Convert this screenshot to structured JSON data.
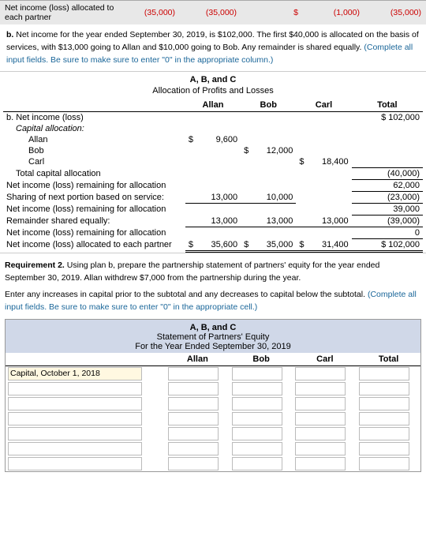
{
  "topRow": {
    "label": "Net income (loss) allocated to each partner",
    "values": [
      "(35,000)",
      "(35,000)",
      "$",
      "(1,000)",
      "(35,000)"
    ]
  },
  "noteB": {
    "text": "b. Net income for the year ended September 30, 2019, is $102,000. The first $40,000 is allocated on the basis of services, with $13,000 going to Allan and $10,000 going to Bob. Any remainder is shared equally.",
    "highlight": "(Complete all input fields. Be sure to make sure to enter \"0\" in the appropriate column.)"
  },
  "allocationTable": {
    "title": "A, B, and C",
    "subtitle": "Allocation of Profits and Losses",
    "headers": [
      "Allan",
      "Bob",
      "Carl",
      "Total"
    ],
    "rows": [
      {
        "label": "b. Net income (loss)",
        "indent": 0,
        "allan": "",
        "bob": "",
        "carl": "",
        "total": "$ 102,000",
        "totalClass": ""
      },
      {
        "label": "Capital allocation:",
        "indent": 0,
        "allan": "",
        "bob": "",
        "carl": "",
        "total": "",
        "bold": true
      },
      {
        "label": "Allan",
        "indent": 2,
        "allan": "9,600",
        "allanPrefix": "$",
        "bob": "",
        "carl": "",
        "total": ""
      },
      {
        "label": "Bob",
        "indent": 2,
        "allan": "",
        "bob": "12,000",
        "bobPrefix": "$",
        "carl": "",
        "total": ""
      },
      {
        "label": "Carl",
        "indent": 2,
        "allan": "",
        "bob": "",
        "carl": "18,400",
        "carlPrefix": "$",
        "total": ""
      },
      {
        "label": "Total capital allocation",
        "indent": 0,
        "allan": "",
        "bob": "",
        "carl": "",
        "total": "(40,000)",
        "totalParen": true
      },
      {
        "label": "Net income (loss) remaining for allocation",
        "indent": 0,
        "allan": "",
        "bob": "",
        "carl": "",
        "total": "62,000"
      },
      {
        "label": "Sharing of next portion based on service:",
        "indent": 0,
        "allan": "13,000",
        "bob": "10,000",
        "carl": "",
        "total": "(23,000)",
        "totalParen": true
      },
      {
        "label": "Net income (loss) remaining for allocation",
        "indent": 0,
        "allan": "",
        "bob": "",
        "carl": "",
        "total": "39,000"
      },
      {
        "label": "Remainder shared equally:",
        "indent": 0,
        "allan": "13,000",
        "bob": "13,000",
        "carl": "13,000",
        "total": "(39,000)",
        "totalParen": true
      },
      {
        "label": "Net income (loss) remaining for allocation",
        "indent": 0,
        "allan": "",
        "bob": "",
        "carl": "",
        "total": "0"
      },
      {
        "label": "Net income (loss) allocated to each partner",
        "indent": 0,
        "allan": "35,600",
        "allanPrefix": "$",
        "bob": "35,000",
        "bobPrefix": "$",
        "carl": "31,400",
        "carlPrefix": "$",
        "total": "$ 102,000",
        "doubleUnderline": true
      }
    ]
  },
  "req2": {
    "label": "Requirement 2.",
    "text": "Using plan b, prepare the partnership statement of partners' equity for the year ended September 30, 2019. Allan withdrew $7,000 from the partnership during the year.",
    "enterNote": "Enter any increases in capital prior to the subtotal and any decreases to capital below the subtotal.",
    "highlight": "(Complete all input fields. Be sure to make sure to enter \"0\" in the appropriate cell.)"
  },
  "statementTable": {
    "title": "A, B, and C",
    "subtitle": "Statement of Partners' Equity",
    "forPeriod": "For the Year Ended September 30, 2019",
    "headers": [
      "Allan",
      "Bob",
      "Carl",
      "Total"
    ],
    "firstRow": {
      "label": "Capital, October 1, 2018",
      "labelHighlight": true
    },
    "editRows": [
      {
        "id": "row1"
      },
      {
        "id": "row2"
      },
      {
        "id": "row3"
      },
      {
        "id": "row4"
      },
      {
        "id": "row5"
      },
      {
        "id": "row6"
      }
    ]
  }
}
